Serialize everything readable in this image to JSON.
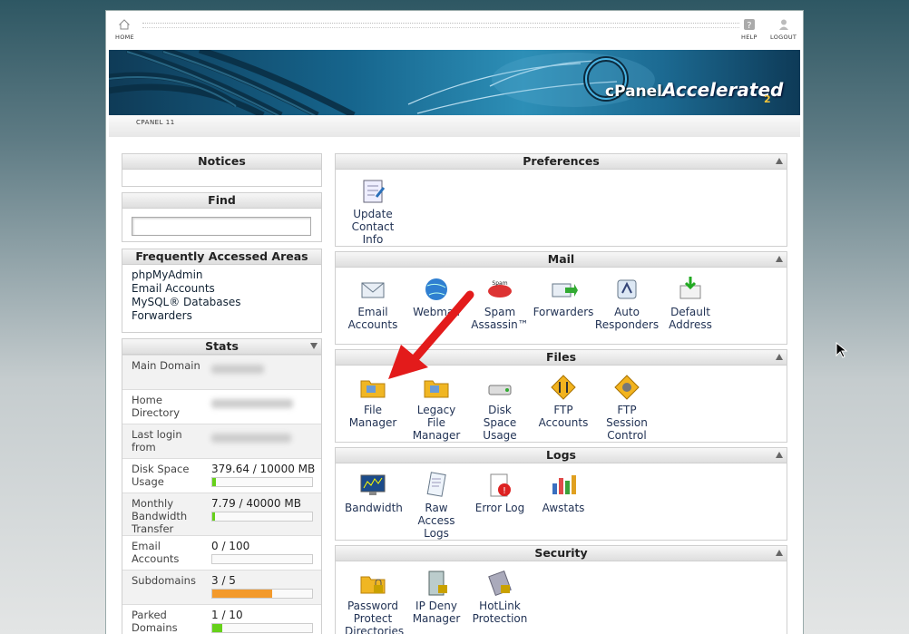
{
  "top": {
    "home": "HOME",
    "help": "HELP",
    "logout": "LOGOUT",
    "version": "CPANEL 11"
  },
  "banner": {
    "logo": "cPanel",
    "accelerated": "Accelerated",
    "sub": "2"
  },
  "notices": {
    "title": "Notices"
  },
  "find": {
    "title": "Find",
    "value": ""
  },
  "faa": {
    "title": "Frequently Accessed Areas",
    "links": [
      "phpMyAdmin",
      "Email Accounts",
      "MySQL® Databases",
      "Forwarders"
    ]
  },
  "stats": {
    "title": "Stats",
    "rows": [
      {
        "label": "Main Domain",
        "value": ""
      },
      {
        "label": "Home Directory",
        "value": ""
      },
      {
        "label": "Last login from",
        "value": ""
      },
      {
        "label": "Disk Space Usage",
        "value": "379.64 / 10000 MB",
        "progress": 0.038
      },
      {
        "label": "Monthly Bandwidth Transfer",
        "value": "7.79 / 40000 MB",
        "progress": 0.0002
      },
      {
        "label": "Email Accounts",
        "value": "0 / 100",
        "progress": 0
      },
      {
        "label": "Subdomains",
        "value": "3 / 5",
        "progress": 0.6
      },
      {
        "label": "Parked Domains",
        "value": "1 / 10",
        "progress": 0.1
      }
    ]
  },
  "sections": {
    "preferences": {
      "title": "Preferences",
      "items": [
        "Update Contact Info"
      ]
    },
    "mail": {
      "title": "Mail",
      "items": [
        "Email Accounts",
        "Webmail",
        "Spam Assassin™",
        "Forwarders",
        "Auto Responders",
        "Default Address"
      ]
    },
    "files": {
      "title": "Files",
      "items": [
        "File Manager",
        "Legacy File Manager",
        "Disk Space Usage",
        "FTP Accounts",
        "FTP Session Control"
      ]
    },
    "logs": {
      "title": "Logs",
      "items": [
        "Bandwidth",
        "Raw Access Logs",
        "Error Log",
        "Awstats"
      ]
    },
    "security": {
      "title": "Security",
      "items": [
        "Password Protect Directories",
        "IP Deny Manager",
        "HotLink Protection"
      ]
    }
  },
  "colors": {
    "progress_green": "#66d11a",
    "progress_orange": "#f39a2c",
    "arrow": "#e31b1b"
  }
}
